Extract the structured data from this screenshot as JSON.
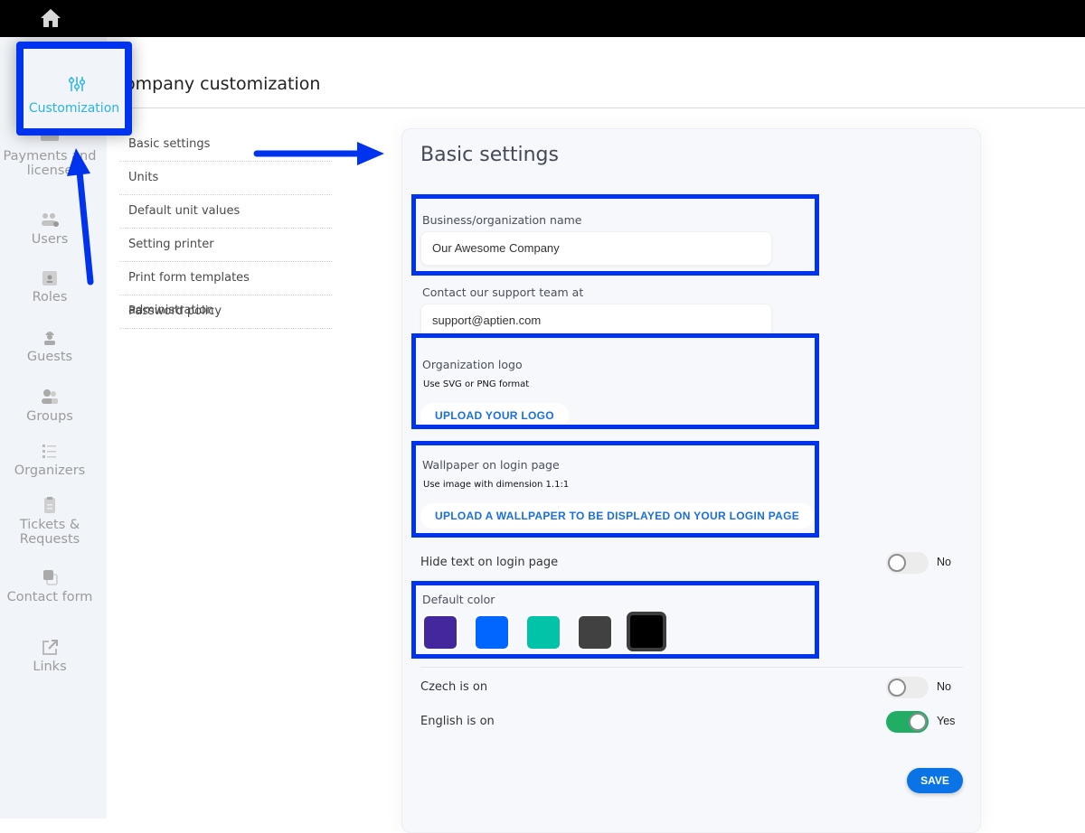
{
  "topbar": {
    "home_icon": "home-icon"
  },
  "sidebar": {
    "active": {
      "label": "Customization",
      "icon": "sliders-icon",
      "color": "#2ab4e6"
    },
    "items": [
      {
        "label": "Payments and license",
        "icon": "credit-card-icon"
      },
      {
        "label": "Users",
        "icon": "users-gear-icon"
      },
      {
        "label": "Roles",
        "icon": "id-badge-icon"
      },
      {
        "label": "Guests",
        "icon": "hard-hat-user-icon"
      },
      {
        "label": "Groups",
        "icon": "user-group-icon"
      },
      {
        "label": "Organizers",
        "icon": "list-icon"
      },
      {
        "label": "Tickets & Requests",
        "icon": "clipboard-icon"
      },
      {
        "label": "Contact form",
        "icon": "clone-icon"
      },
      {
        "label": "Links",
        "icon": "external-link-icon"
      }
    ]
  },
  "page": {
    "title": "ompany customization"
  },
  "submenu": {
    "items": [
      "Basic settings",
      "Units",
      "Default unit values",
      "Setting printer",
      "Print form templates administration",
      "Password policy"
    ]
  },
  "card": {
    "title": "Basic settings",
    "business_name": {
      "label": "Business/organization name",
      "value": "Our Awesome Company"
    },
    "support": {
      "label": "Contact our support team at",
      "value": "support@aptien.com"
    },
    "logo": {
      "label": "Organization logo",
      "hint": "Use SVG or PNG format",
      "button": "UPLOAD YOUR LOGO"
    },
    "wallpaper": {
      "label": "Wallpaper on login page",
      "hint": "Use image with dimension 1.1:1",
      "button": "UPLOAD A WALLPAPER TO BE DISPLAYED ON YOUR LOGIN PAGE"
    },
    "hide_text": {
      "label": "Hide text on login page",
      "state": "No"
    },
    "default_color": {
      "label": "Default color",
      "swatches": [
        "#42289c",
        "#0066ff",
        "#00c3a8",
        "#414141",
        "#000000"
      ],
      "selected_index": 4
    },
    "czech": {
      "label": "Czech is on",
      "state": "No"
    },
    "english": {
      "label": "English is on",
      "state": "Yes"
    },
    "save_label": "SAVE"
  },
  "annotation_color": "#0033ee"
}
